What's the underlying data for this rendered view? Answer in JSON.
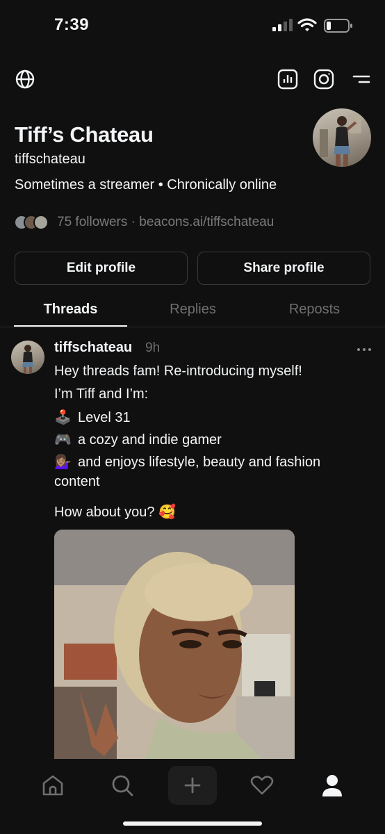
{
  "status_bar": {
    "time": "7:39"
  },
  "profile": {
    "name": "Tiff’s Chateau",
    "handle": "tiffschateau",
    "bio": "Sometimes a streamer • Chronically online",
    "followers": "75 followers",
    "separator": "·",
    "link": "beacons.ai/tiffschateau"
  },
  "buttons": {
    "edit": "Edit profile",
    "share": "Share profile"
  },
  "tabs": [
    {
      "label": "Threads",
      "active": true
    },
    {
      "label": "Replies",
      "active": false
    },
    {
      "label": "Reposts",
      "active": false
    }
  ],
  "post": {
    "username": "tiffschateau",
    "time": "9h",
    "lines": [
      "Hey threads fam! Re-introducing myself!",
      "I’m Tiff and I’m:",
      "Level 31",
      "a cozy and indie gamer",
      "and enjoys lifestyle, beauty and fashion",
      "content",
      "How about you?"
    ],
    "emojis": {
      "joystick": "🕹️",
      "controller": "🎮",
      "person": "💁🏽‍♀️",
      "smile": "🥰"
    }
  },
  "icons": {
    "globe": "globe-icon",
    "insights": "bar-chart-icon",
    "instagram": "instagram-icon",
    "menu": "menu-icon"
  },
  "colors": {
    "background": "#101010",
    "text": "#f3f5f7",
    "muted": "#6f6f6f",
    "border": "#3a3a3a"
  }
}
